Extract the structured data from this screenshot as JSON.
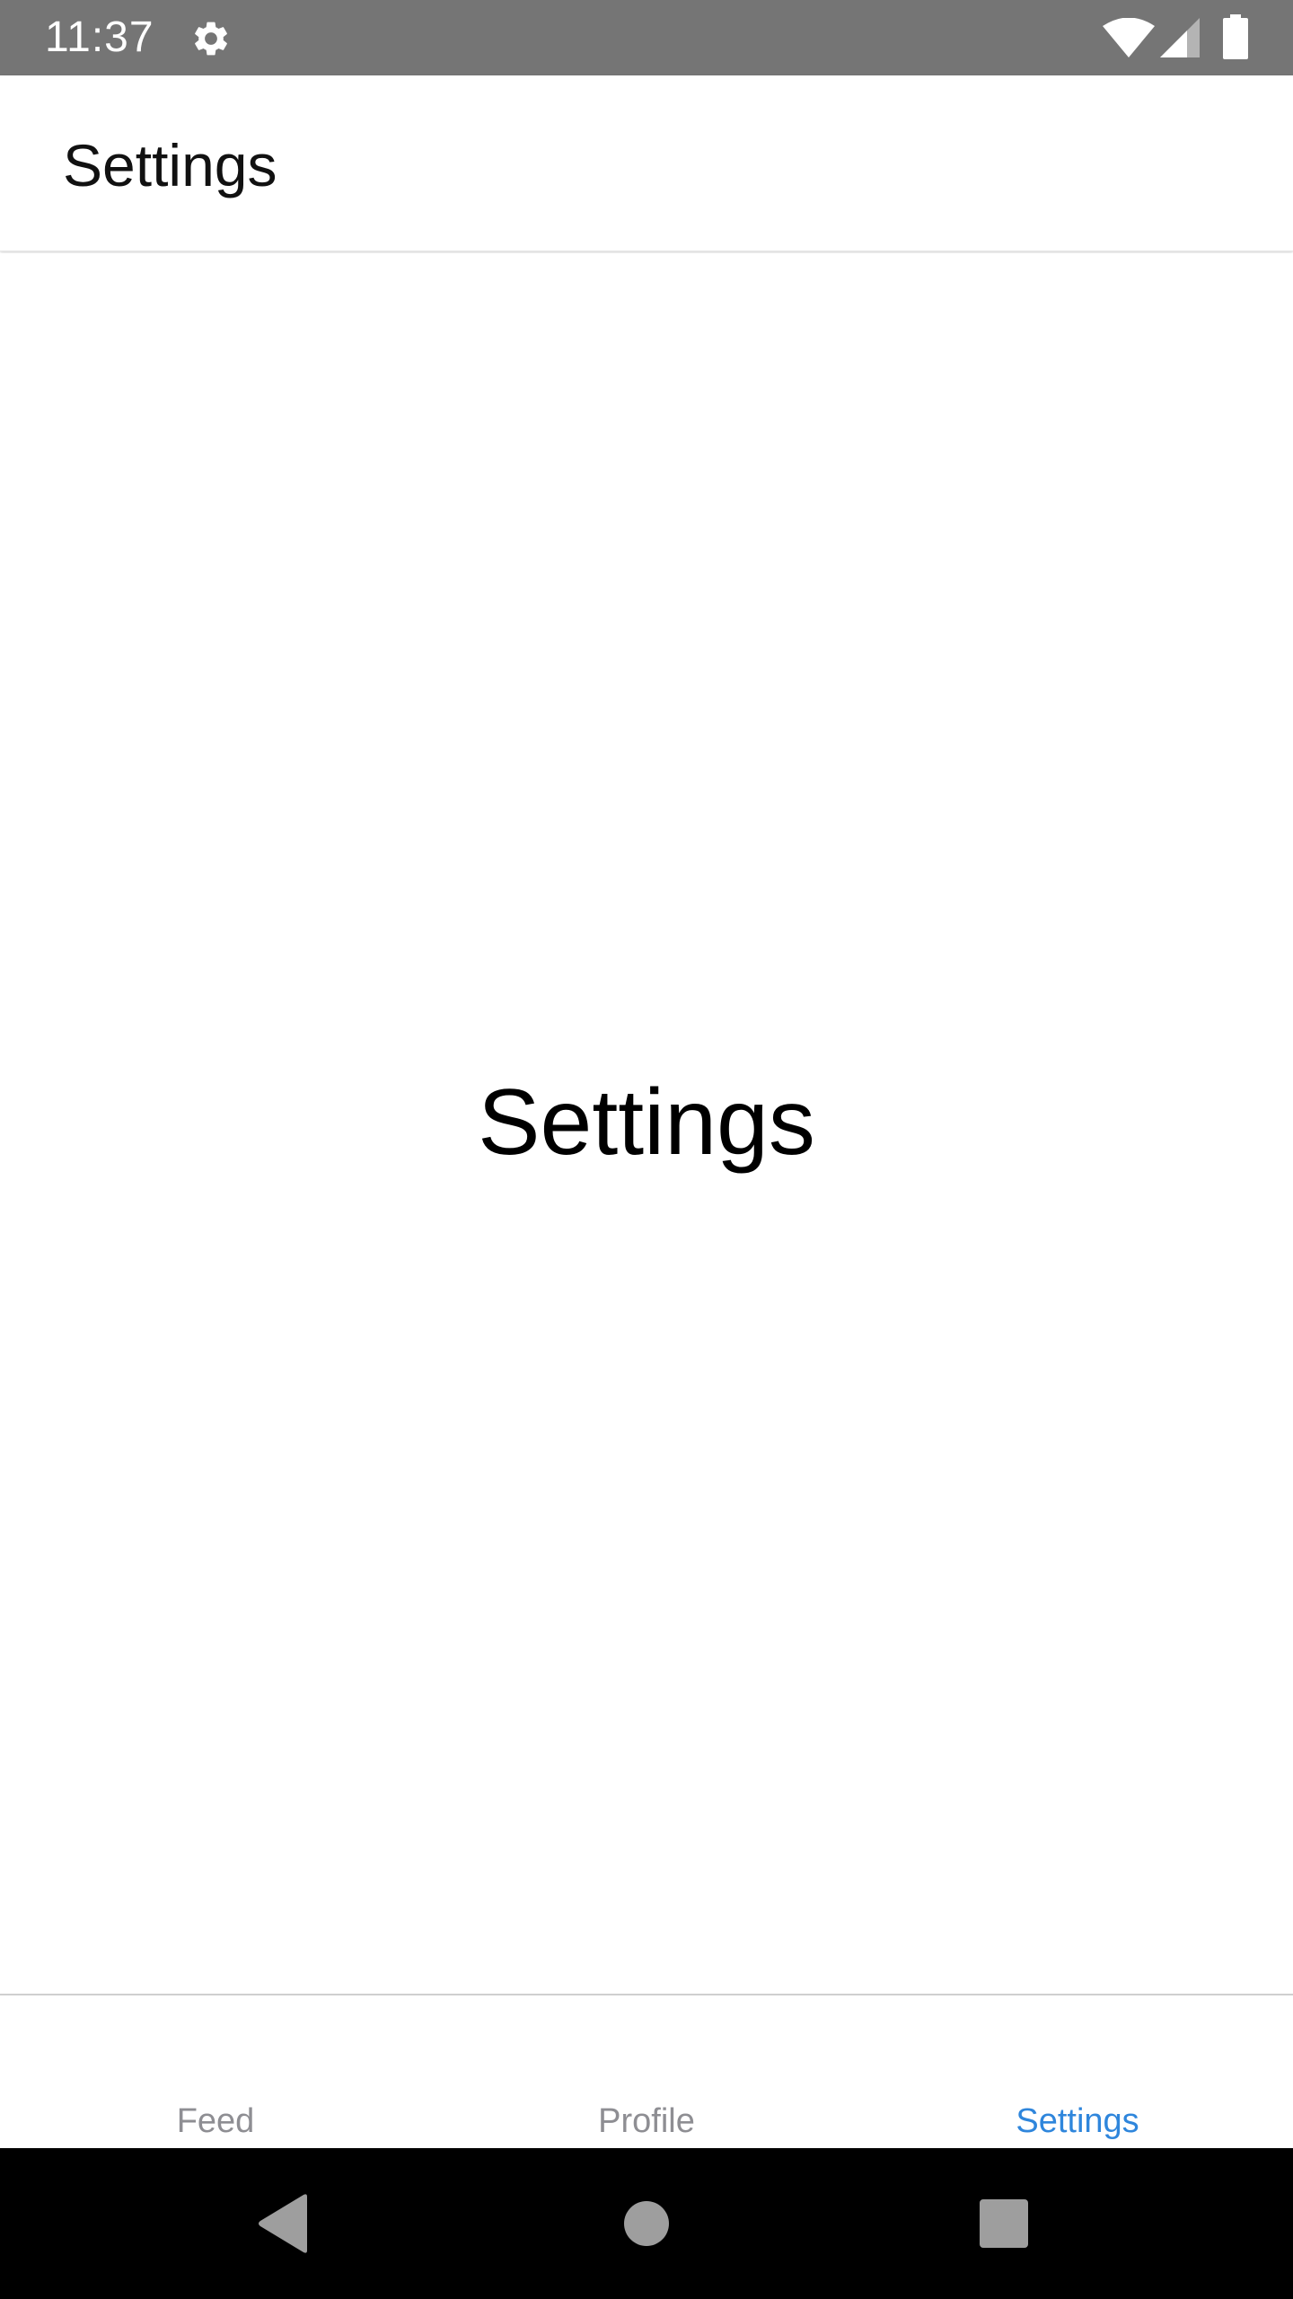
{
  "status_bar": {
    "time": "11:37",
    "icons": [
      "gear-icon",
      "wifi-icon",
      "cell-signal-icon",
      "battery-icon"
    ],
    "background_color": "#757575"
  },
  "app_bar": {
    "title": "Settings"
  },
  "content": {
    "heading": "Settings"
  },
  "tab_bar": {
    "active_color": "#2f86dc",
    "inactive_color": "#8e8e93",
    "tabs": [
      {
        "label": "Feed",
        "active": false
      },
      {
        "label": "Profile",
        "active": false
      },
      {
        "label": "Settings",
        "active": true
      }
    ]
  },
  "nav_bar": {
    "buttons": [
      "back-icon",
      "home-icon",
      "recents-icon"
    ]
  }
}
